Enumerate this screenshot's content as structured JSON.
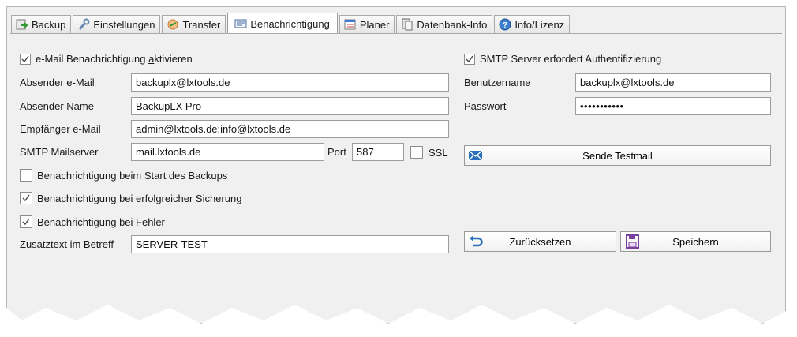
{
  "tabs": [
    {
      "label": "Backup",
      "icon": "backup-icon",
      "active": false
    },
    {
      "label": "Einstellungen",
      "icon": "wrench-icon",
      "active": false
    },
    {
      "label": "Transfer",
      "icon": "transfer-icon",
      "active": false
    },
    {
      "label": "Benachrichtigung",
      "icon": "notification-icon",
      "active": true
    },
    {
      "label": "Planer",
      "icon": "calendar-icon",
      "active": false
    },
    {
      "label": "Datenbank-Info",
      "icon": "database-icon",
      "active": false
    },
    {
      "label": "Info/Lizenz",
      "icon": "info-icon",
      "active": false
    }
  ],
  "notify": {
    "enable_pre": "e-Mail Benachrichtigung ",
    "enable_accel": "a",
    "enable_post": "ktivieren",
    "enable_checked": true,
    "sender_email_label": "Absender e-Mail",
    "sender_email": "backuplx@lxtools.de",
    "sender_name_label": "Absender Name",
    "sender_name": "BackupLX Pro",
    "recipient_label": "Empfänger e-Mail",
    "recipient": "admin@lxtools.de;info@lxtools.de",
    "smtp_label": "SMTP Mailserver",
    "smtp_server": "mail.lxtools.de",
    "port_label": "Port",
    "port": "587",
    "ssl_label": "SSL",
    "ssl_checked": false,
    "on_start_label": "Benachrichtigung beim Start des Backups",
    "on_start_checked": false,
    "on_success_label": "Benachrichtigung bei erfolgreicher Sicherung",
    "on_success_checked": true,
    "on_error_label": "Benachrichtigung bei Fehler",
    "on_error_checked": true,
    "subject_label": "Zusatztext im Betreff",
    "subject": "SERVER-TEST"
  },
  "auth": {
    "requires_auth_label": "SMTP Server erfordert Authentifizierung",
    "requires_auth_checked": true,
    "username_label": "Benutzername",
    "username": "backuplx@lxtools.de",
    "password_label": "Passwort",
    "password_masked": "•••••••••••"
  },
  "buttons": {
    "test_mail": "Sende Testmail",
    "reset": "Zurücksetzen",
    "save": "Speichern"
  },
  "colors": {
    "accent_blue": "#2a6ebb",
    "save_purple": "#7b3f9e",
    "check_mark": "#444444"
  }
}
